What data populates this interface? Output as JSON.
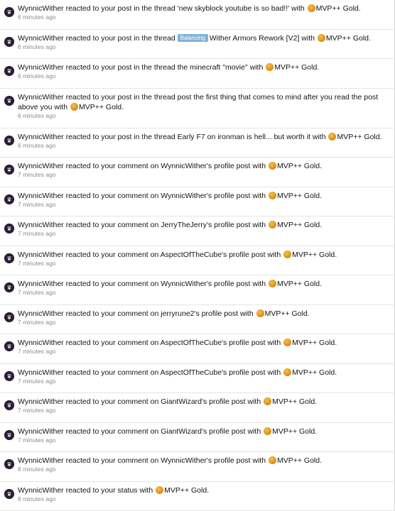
{
  "alerts": [
    {
      "user": "WynnicWither",
      "text": " reacted to your post in the thread ",
      "prefix": "",
      "thread": "'new skyblock youtube is so bad!!'",
      "after": " with ",
      "reaction": "MVP++ Gold",
      "end": ".",
      "time": "6 minutes ago",
      "lines": 1
    },
    {
      "user": "WynnicWither",
      "text": " reacted to your post in the thread ",
      "prefix": "Balancing",
      "thread": "Wither Armors Rework [V2]",
      "after": " with ",
      "reaction": "MVP++ Gold",
      "end": ".",
      "time": "6 minutes ago",
      "lines": 1
    },
    {
      "user": "WynnicWither",
      "text": " reacted to your post in the thread ",
      "prefix": "",
      "thread": "the minecraft \"movie\"",
      "after": " with ",
      "reaction": "MVP++ Gold",
      "end": ".",
      "time": "6 minutes ago",
      "lines": 1
    },
    {
      "user": "WynnicWither",
      "text": " reacted to your post in the thread ",
      "prefix": "",
      "thread": "post the first thing that comes to mind after you read the post above you",
      "after": " with ",
      "reaction": "MVP++ Gold",
      "end": ".",
      "time": "6 minutes ago",
      "lines": 2,
      "line1": " reacted to your post in the thread post the first thing that comes to mind after you read the post",
      "line2": "above you with "
    },
    {
      "user": "WynnicWither",
      "text": " reacted to your post in the thread ",
      "prefix": "",
      "thread": "Early F7 on ironman is hell... but worth it",
      "after": " with ",
      "reaction": "MVP++ Gold",
      "end": ".",
      "time": "6 minutes ago",
      "lines": 1
    },
    {
      "user": "WynnicWither",
      "text": " reacted to your comment on ",
      "prefix": "",
      "thread": "WynnicWither's profile post",
      "after": " with ",
      "reaction": "MVP++ Gold",
      "end": ".",
      "time": "7 minutes ago",
      "lines": 1
    },
    {
      "user": "WynnicWither",
      "text": " reacted to your comment on ",
      "prefix": "",
      "thread": "WynnicWither's profile post",
      "after": " with ",
      "reaction": "MVP++ Gold",
      "end": ".",
      "time": "7 minutes ago",
      "lines": 1
    },
    {
      "user": "WynnicWither",
      "text": " reacted to your comment on ",
      "prefix": "",
      "thread": "JerryTheJerry's profile post",
      "after": " with ",
      "reaction": "MVP++ Gold",
      "end": ".",
      "time": "7 minutes ago",
      "lines": 1
    },
    {
      "user": "WynnicWither",
      "text": " reacted to your comment on ",
      "prefix": "",
      "thread": "AspectOfTheCube's profile post",
      "after": " with ",
      "reaction": "MVP++ Gold",
      "end": ".",
      "time": "7 minutes ago",
      "lines": 1
    },
    {
      "user": "WynnicWither",
      "text": " reacted to your comment on ",
      "prefix": "",
      "thread": "WynnicWither's profile post",
      "after": " with ",
      "reaction": "MVP++ Gold",
      "end": ".",
      "time": "7 minutes ago",
      "lines": 1
    },
    {
      "user": "WynnicWither",
      "text": " reacted to your comment on ",
      "prefix": "",
      "thread": "jerryrune2's profile post",
      "after": " with ",
      "reaction": "MVP++ Gold",
      "end": ".",
      "time": "7 minutes ago",
      "lines": 1
    },
    {
      "user": "WynnicWither",
      "text": " reacted to your comment on ",
      "prefix": "",
      "thread": "AspectOfTheCube's profile post",
      "after": " with ",
      "reaction": "MVP++ Gold",
      "end": ".",
      "time": "7 minutes ago",
      "lines": 1
    },
    {
      "user": "WynnicWither",
      "text": " reacted to your comment on ",
      "prefix": "",
      "thread": "AspectOfTheCube's profile post",
      "after": " with ",
      "reaction": "MVP++ Gold",
      "end": ".",
      "time": "7 minutes ago",
      "lines": 1
    },
    {
      "user": "WynnicWither",
      "text": " reacted to your comment on ",
      "prefix": "",
      "thread": "GiantWizard's profile post",
      "after": " with ",
      "reaction": "MVP++ Gold",
      "end": ".",
      "time": "7 minutes ago",
      "lines": 1
    },
    {
      "user": "WynnicWither",
      "text": " reacted to your comment on ",
      "prefix": "",
      "thread": "GiantWizard's profile post",
      "after": " with ",
      "reaction": "MVP++ Gold",
      "end": ".",
      "time": "7 minutes ago",
      "lines": 1
    },
    {
      "user": "WynnicWither",
      "text": " reacted to your comment on ",
      "prefix": "",
      "thread": "WynnicWither's profile post",
      "after": " with ",
      "reaction": "MVP++ Gold",
      "end": ".",
      "time": "8 minutes ago",
      "lines": 1
    },
    {
      "user": "WynnicWither",
      "text": " reacted to your ",
      "prefix": "",
      "thread": "status",
      "after": " with ",
      "reaction": "MVP++ Gold",
      "end": ".",
      "time": "8 minutes ago",
      "lines": 1
    }
  ],
  "colors": {
    "prefix_bg": "#7fb3d9",
    "timestamp": "#8c8c8c",
    "divider": "#e4e4e4"
  }
}
